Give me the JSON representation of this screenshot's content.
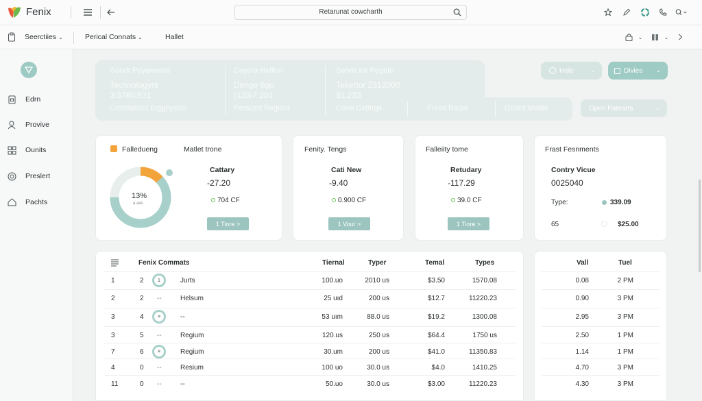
{
  "app": {
    "brand": "Fenix"
  },
  "search": {
    "text": "Retarunat cowcharth"
  },
  "subnav": {
    "dropdown": "Seerctiies",
    "tab1": "Perical Connats",
    "tab2": "Hallet"
  },
  "sidebar": {
    "items": [
      {
        "label": "Edrn",
        "icon": "document-lock-icon"
      },
      {
        "label": "Provive",
        "icon": "user-icon"
      },
      {
        "label": "Ounits",
        "icon": "grid-icon"
      },
      {
        "label": "Preslert",
        "icon": "target-icon"
      },
      {
        "label": "Pachts",
        "icon": "home-icon"
      }
    ]
  },
  "hero": {
    "col1": [
      "Goodt Peyerverce",
      "Technologynt",
      "3:3780,931",
      "Cromlaliard Eiggoysion"
    ],
    "col2": [
      "Coyera Hellion",
      "Denge 6go",
      "(133/7.201",
      "Perscert Regiont"
    ],
    "col3": [
      "Servis tor Pegeto",
      "Tekertor 2312000",
      "$1.233",
      "Corel Cettirgs"
    ],
    "tail": [
      "Funta Raips",
      "Goord Matlet"
    ]
  },
  "pills": {
    "hole": "Hole",
    "divies": "Divies",
    "open": "Open Patearts"
  },
  "cards": {
    "c1": {
      "legend": "Falledueng",
      "title": "Matlet trone",
      "percent": "13%",
      "percent_sub": "a avs",
      "label": "Cattary",
      "value": "-27.20",
      "delta": "704 CF",
      "button": "1 Tiore >",
      "progress": 0.13
    },
    "c2": {
      "title": "Fenity. Tengs",
      "label": "Cati New",
      "value": "-9.40",
      "delta": "0.900 CF",
      "button": "1 Vour >"
    },
    "c3": {
      "title": "Falleiity tome",
      "label": "Retudary",
      "value": "-117.29",
      "delta": "39.0 CF",
      "button": "1 Tiore >"
    },
    "c4": {
      "title": "Frast Fesnments",
      "label": "Contry Vicue",
      "value": "0025040",
      "row1_label": "Type:",
      "row1_value": "339.09",
      "row2_label": "65",
      "row2_value": "$25.00"
    }
  },
  "table": {
    "title": "Fenix Commats",
    "headers": [
      "Tiernal",
      "Typer",
      "Temal",
      "Types"
    ],
    "side_headers": [
      "Vall",
      "Tuel"
    ],
    "rows": [
      {
        "idx": "1",
        "n": "2",
        "icon": "1",
        "name": "Jurts",
        "c1": "100.uo",
        "c2": "2010 us",
        "c3": "$3.50",
        "c4": "1570.08",
        "v": "0.08",
        "t": "2 PM"
      },
      {
        "idx": "2",
        "n": "2",
        "icon": "",
        "name": "Helsum",
        "c1": "25 uıd",
        "c2": "200 us",
        "c3": "$12.7",
        "c4": "11220.23",
        "v": "0.90",
        "t": "3 PM"
      },
      {
        "idx": "3",
        "n": "4",
        "icon": "≡",
        "name": "--",
        "c1": "53 uım",
        "c2": "88.0 us",
        "c3": "$19.2",
        "c4": "1300.08",
        "v": "2.95",
        "t": "3 PM"
      },
      {
        "idx": "3",
        "n": "5",
        "icon": "",
        "name": "Regium",
        "c1": "120.us",
        "c2": "250 us",
        "c3": "$64.4",
        "c4": "1750 us",
        "v": "2.50",
        "t": "1 PM"
      },
      {
        "idx": "7",
        "n": "6",
        "icon": "≡",
        "name": "Regium",
        "c1": "30.um",
        "c2": "200 us",
        "c3": "$41.0",
        "c4": "11350.83",
        "v": "1.14",
        "t": "1 PM"
      },
      {
        "idx": "4",
        "n": "0",
        "icon": "",
        "name": "Resium",
        "c1": "100 uo",
        "c2": "30.0 us",
        "c3": "$4.0",
        "c4": "1410.25",
        "v": "4.70",
        "t": "3 PM"
      },
      {
        "idx": "11",
        "n": "0",
        "icon": "",
        "name": "--",
        "c1": "50.uo",
        "c2": "30.0 us",
        "c3": "$3.00",
        "c4": "11220.23",
        "v": "4.30",
        "t": "3 PM"
      }
    ]
  },
  "colors": {
    "accent": "#9dc5c0",
    "donut": "#a7d0cb",
    "orange": "#f2a33a",
    "positive": "#6cc25b"
  }
}
